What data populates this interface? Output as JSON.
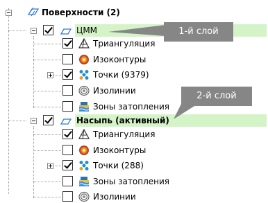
{
  "root": {
    "label": "Поверхности (2)"
  },
  "layers": [
    {
      "name": "ЦММ",
      "items": [
        {
          "label": "Триангуляция",
          "icon": "triangulation-icon",
          "checked": true
        },
        {
          "label": "Изоконтуры",
          "icon": "isocontours-icon",
          "checked": false
        },
        {
          "label": "Точки (9379)",
          "icon": "points-icon",
          "checked": true,
          "expandable": true
        },
        {
          "label": "Изолинии",
          "icon": "isolines-icon",
          "checked": false
        },
        {
          "label": "Зоны затопления",
          "icon": "flood-zones-icon",
          "checked": false
        }
      ]
    },
    {
      "name": "Насыпь (активный)",
      "items": [
        {
          "label": "Триангуляция",
          "icon": "triangulation-icon",
          "checked": true
        },
        {
          "label": "Изоконтуры",
          "icon": "isocontours-icon",
          "checked": false
        },
        {
          "label": "Точки (288)",
          "icon": "points-icon",
          "checked": true,
          "expandable": true
        },
        {
          "label": "Зоны затопления",
          "icon": "flood-zones-icon",
          "checked": false
        },
        {
          "label": "Изолинии",
          "icon": "isolines-icon",
          "checked": false
        }
      ]
    }
  ],
  "callouts": {
    "first": "1-й слой",
    "second": "2-й слой"
  },
  "colors": {
    "highlight": "#d4f4c8",
    "callout": "#868686"
  }
}
